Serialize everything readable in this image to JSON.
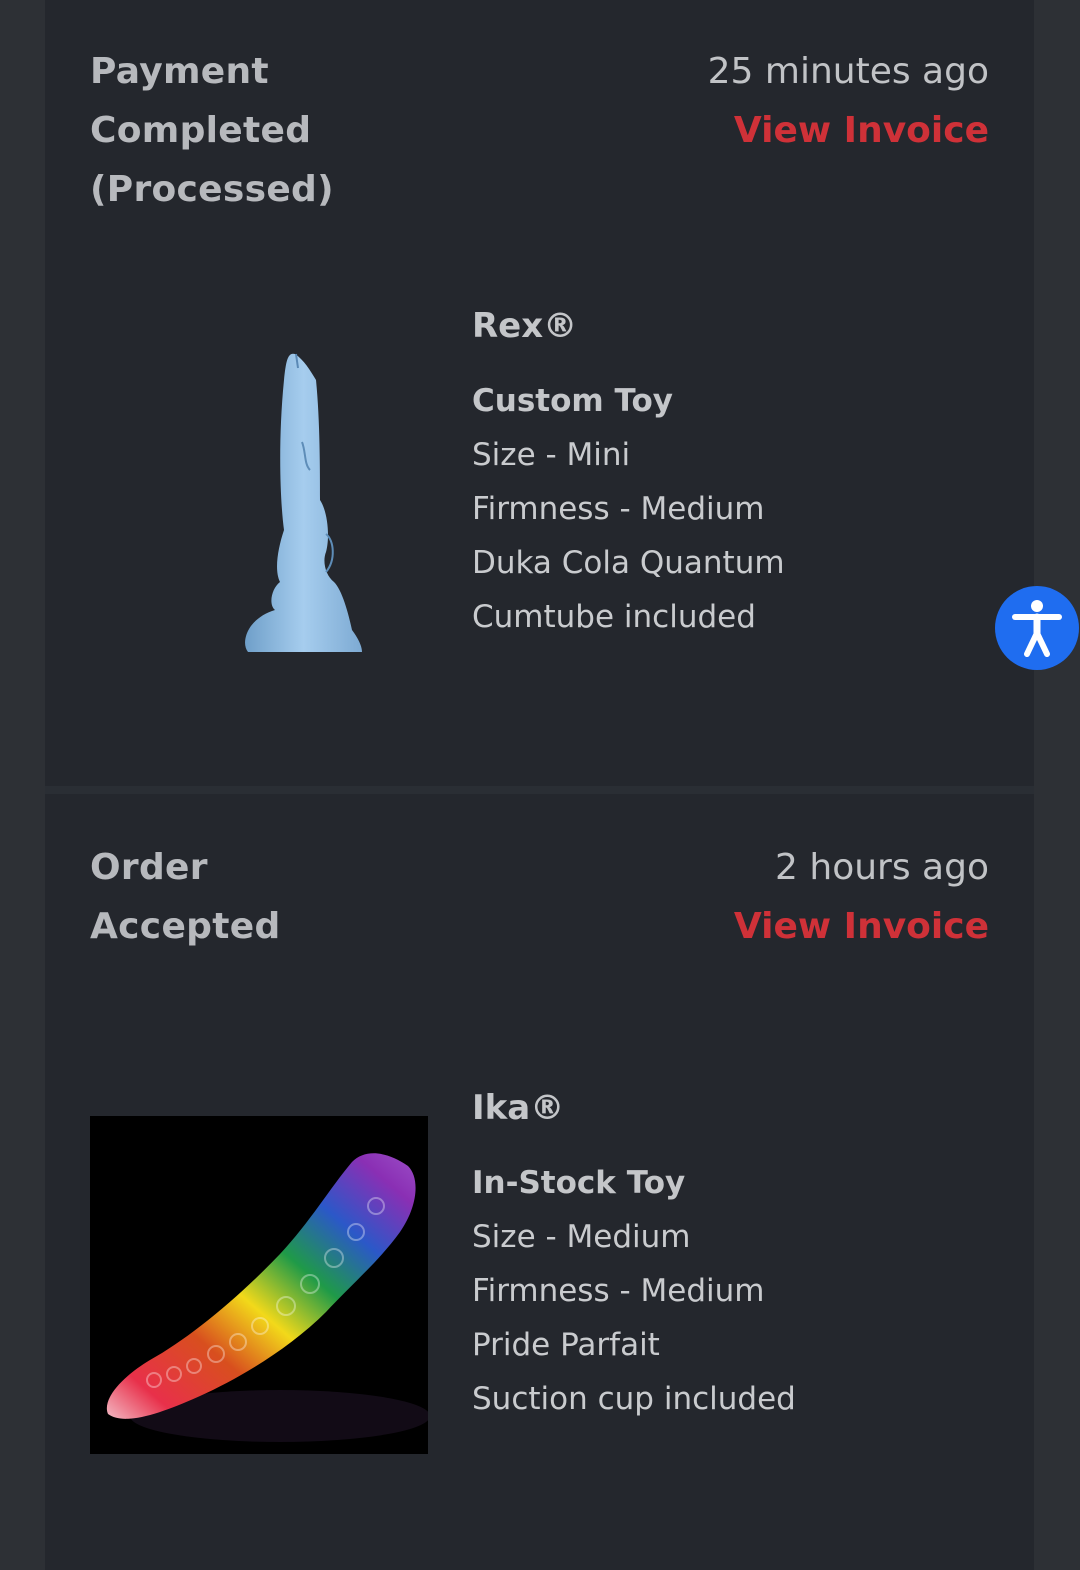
{
  "orders": [
    {
      "status_line1": "Payment",
      "status_line2": "Completed",
      "status_line3": "(Processed)",
      "time": "25 minutes ago",
      "invoice_label": "View Invoice",
      "product": {
        "name": "Rex®",
        "type": "Custom Toy",
        "specs": [
          "Size - Mini",
          "Firmness - Medium",
          "Duka Cola Quantum",
          "Cumtube included"
        ]
      }
    },
    {
      "status_line1": "Order",
      "status_line2": "Accepted",
      "time": "2 hours ago",
      "invoice_label": "View Invoice",
      "product": {
        "name": "Ika®",
        "type": "In-Stock Toy",
        "specs": [
          "Size - Medium",
          "Firmness - Medium",
          "Pride Parfait",
          "Suction cup included"
        ]
      }
    }
  ],
  "accessibility_button": {
    "icon": "accessibility-icon",
    "color": "#1f6df0"
  },
  "colors": {
    "accent": "#cf3138",
    "panel": "#24272d",
    "background": "#2d3035"
  }
}
